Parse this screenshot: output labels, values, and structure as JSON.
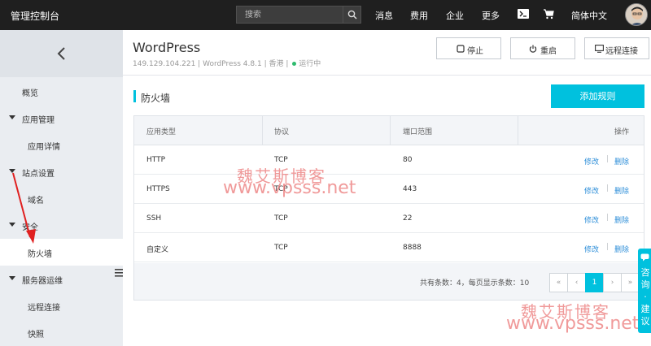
{
  "topbar": {
    "brand": "管理控制台",
    "search_placeholder": "搜索",
    "nav": [
      "消息",
      "费用",
      "企业",
      "更多"
    ],
    "lang": "简体中文",
    "bg_color": "#1f1f1f"
  },
  "sidebar": {
    "items": [
      {
        "label": "概览"
      },
      {
        "label": "应用管理"
      },
      {
        "label": "应用详情"
      },
      {
        "label": "站点设置"
      },
      {
        "label": "域名"
      },
      {
        "label": "安全"
      },
      {
        "label": "防火墙"
      },
      {
        "label": "服务器运维"
      },
      {
        "label": "远程连接"
      },
      {
        "label": "快照"
      }
    ],
    "active": "防火墙"
  },
  "header": {
    "title": "WordPress",
    "ip": "149.129.104.221",
    "version": "WordPress 4.8.1",
    "region": "香港",
    "status": "运行中",
    "sep": "|",
    "buttons": {
      "stop": "停止",
      "restart": "重启",
      "remote": "远程连接"
    }
  },
  "section": {
    "title": "防火墙",
    "add_button": "添加规则",
    "accent_color": "#00c1de"
  },
  "table": {
    "headers": [
      "应用类型",
      "协议",
      "端口范围",
      "操作"
    ],
    "rows": [
      {
        "type": "HTTP",
        "protocol": "TCP",
        "port": "80",
        "edit": "修改",
        "delete": "删除"
      },
      {
        "type": "HTTPS",
        "protocol": "TCP",
        "port": "443",
        "edit": "修改",
        "delete": "删除"
      },
      {
        "type": "SSH",
        "protocol": "TCP",
        "port": "22",
        "edit": "修改",
        "delete": "删除"
      },
      {
        "type": "自定义",
        "protocol": "TCP",
        "port": "8888",
        "edit": "修改",
        "delete": "删除"
      }
    ],
    "op_sep": "|"
  },
  "pagination": {
    "summary": "共有条数：4，每页显示条数：10",
    "first": "«",
    "prev": "‹",
    "current": "1",
    "next": "›",
    "last": "»"
  },
  "watermark": {
    "cn": "魏艾斯博客",
    "en": "www.vpsss.net"
  },
  "consult_tab": {
    "text": "咨询·建议"
  }
}
